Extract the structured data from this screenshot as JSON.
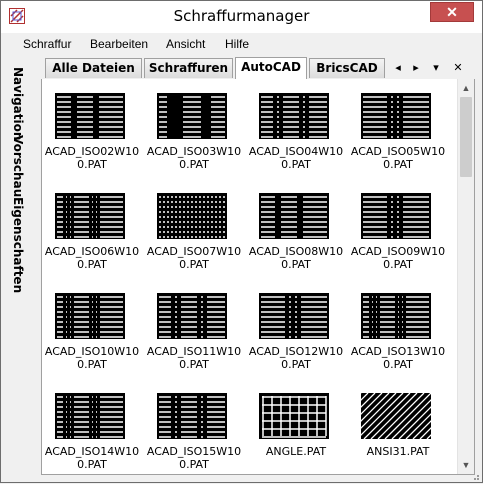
{
  "window": {
    "title": "Schraffurmanager",
    "close_glyph": "✕"
  },
  "menu": [
    "Schraffur",
    "Bearbeiten",
    "Ansicht",
    "Hilfe"
  ],
  "side_tabs": [
    "Navigation",
    "Vorschau",
    "Eigenschaften"
  ],
  "tabs": [
    {
      "label": "Alle Dateien",
      "active": false
    },
    {
      "label": "Schraffuren",
      "active": false
    },
    {
      "label": "AutoCAD",
      "active": true
    },
    {
      "label": "BricsCAD",
      "active": false
    }
  ],
  "tab_controls": {
    "prev": "◂",
    "next": "▸",
    "menu": "▾",
    "close": "✕"
  },
  "scrollbar": {
    "up": "▲",
    "down": "▼"
  },
  "patterns": [
    {
      "name": "ACAD_ISO02W100.PAT",
      "style": "dash"
    },
    {
      "name": "ACAD_ISO03W100.PAT",
      "style": "bigdash"
    },
    {
      "name": "ACAD_ISO04W100.PAT",
      "style": "dashdot"
    },
    {
      "name": "ACAD_ISO05W100.PAT",
      "style": "dashdot2"
    },
    {
      "name": "ACAD_ISO06W100.PAT",
      "style": "dots"
    },
    {
      "name": "ACAD_ISO07W100.PAT",
      "style": "fine-dots"
    },
    {
      "name": "ACAD_ISO08W100.PAT",
      "style": "dash"
    },
    {
      "name": "ACAD_ISO09W100.PAT",
      "style": "dashdot2"
    },
    {
      "name": "ACAD_ISO10W100.PAT",
      "style": "dots"
    },
    {
      "name": "ACAD_ISO11W100.PAT",
      "style": "dashdot"
    },
    {
      "name": "ACAD_ISO12W100.PAT",
      "style": "dashdot2"
    },
    {
      "name": "ACAD_ISO13W100.PAT",
      "style": "dots"
    },
    {
      "name": "ACAD_ISO14W100.PAT",
      "style": "dots"
    },
    {
      "name": "ACAD_ISO15W100.PAT",
      "style": "dashdot"
    },
    {
      "name": "ANGLE.PAT",
      "style": "angle"
    },
    {
      "name": "ANSI31.PAT",
      "style": "diagonal"
    }
  ],
  "icons": {
    "app": "hatch-app-icon",
    "close": "close-icon",
    "grip": "resize-grip-icon"
  }
}
